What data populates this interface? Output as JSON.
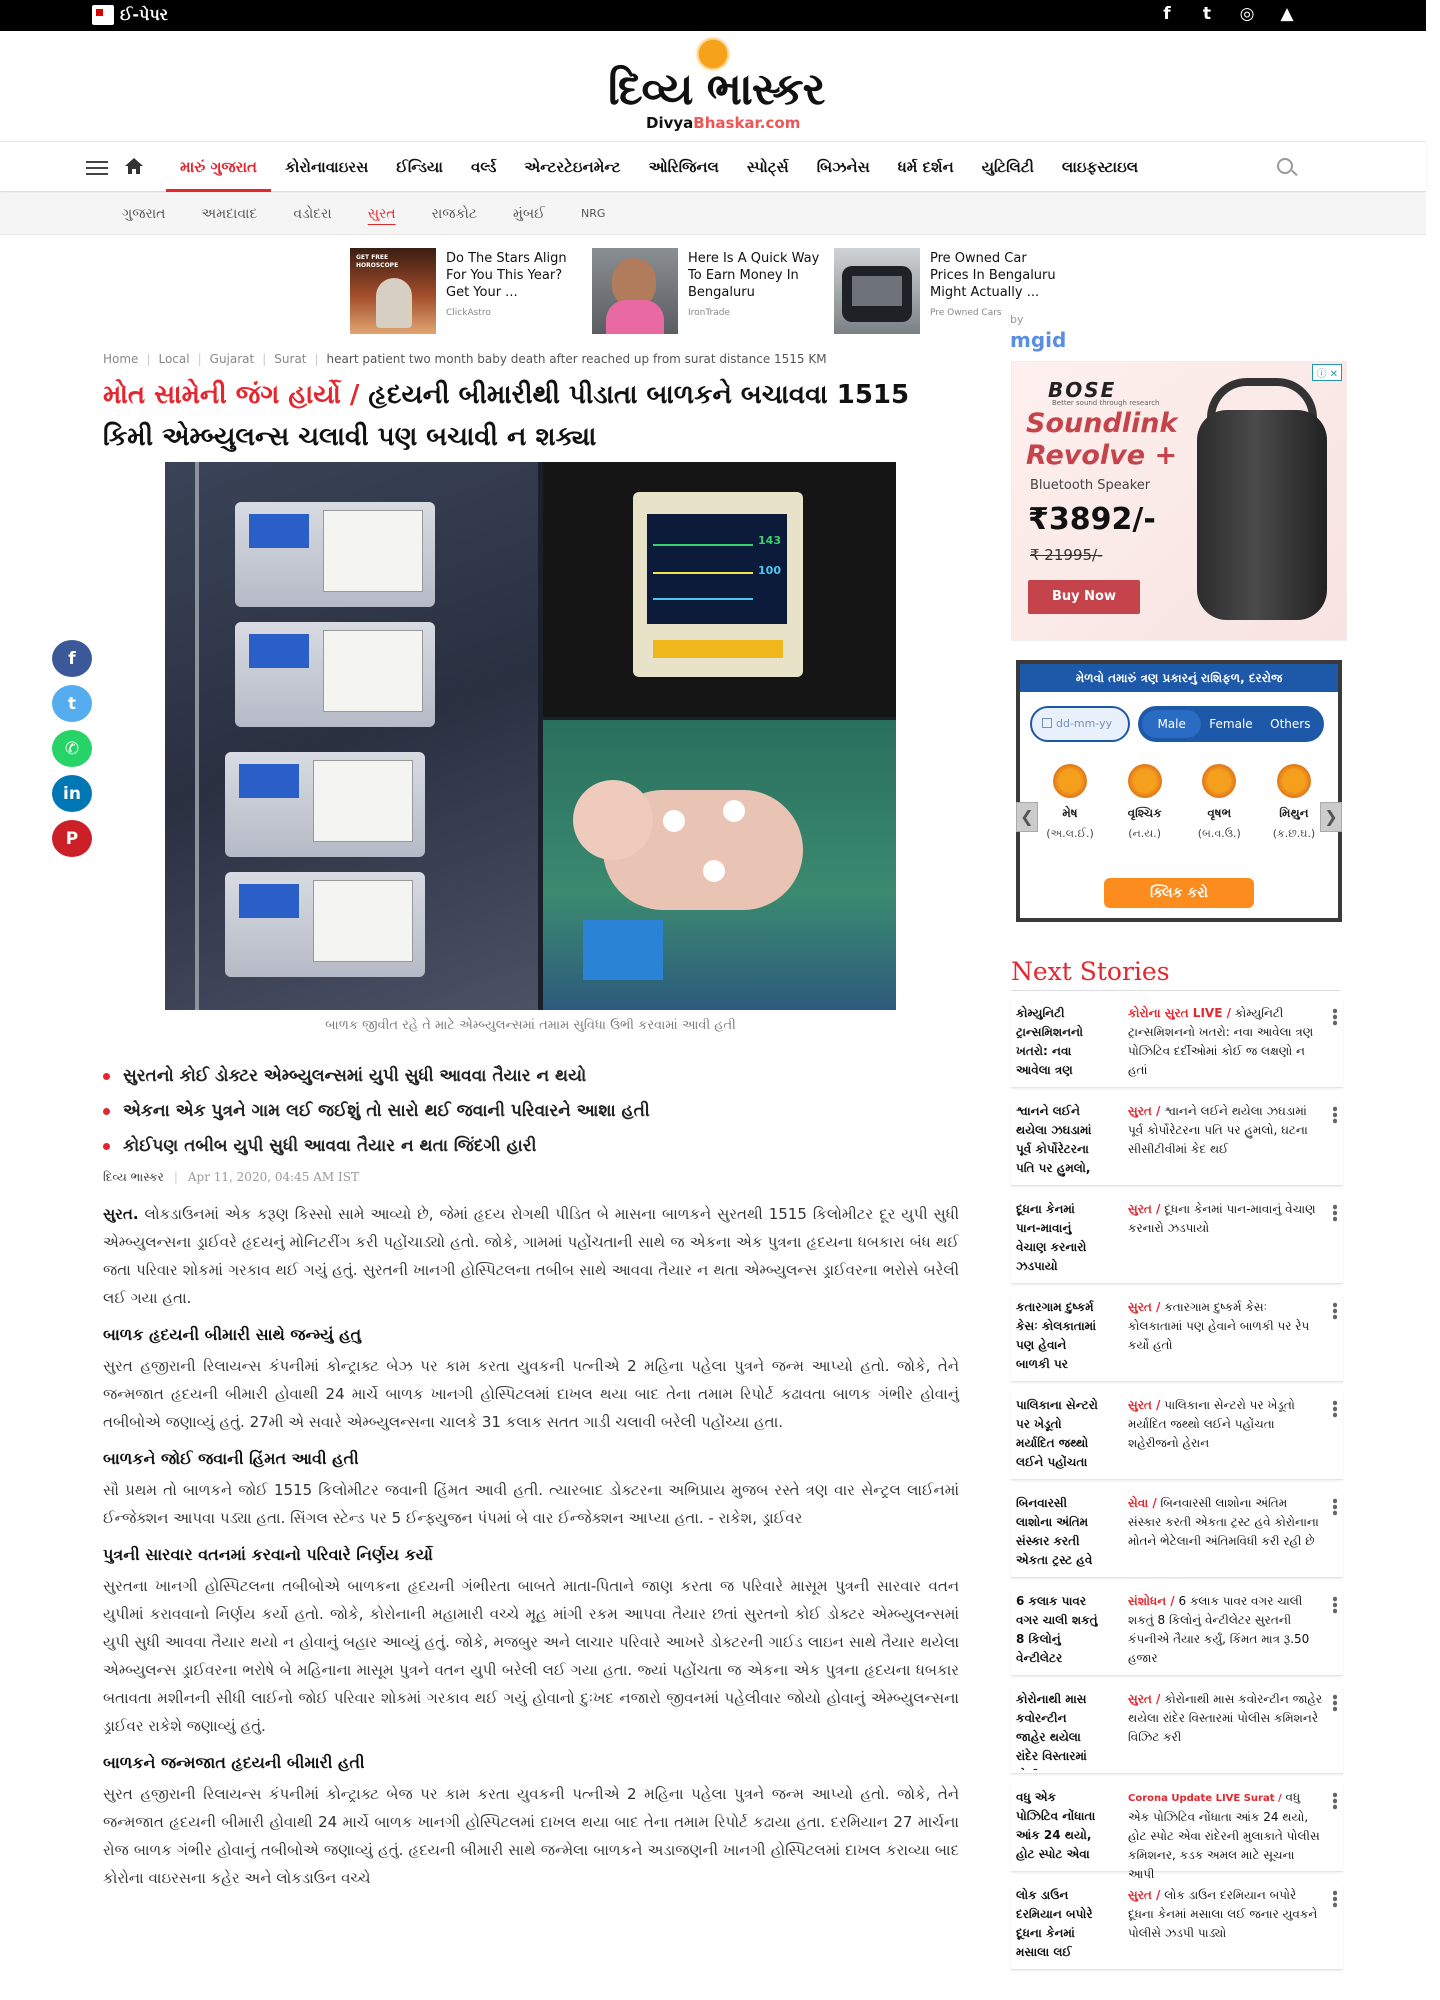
{
  "topbar": {
    "epaper_label": "ઈ-પેપર",
    "social_icons": [
      "facebook-icon",
      "twitter-icon",
      "instagram-icon",
      "android-icon",
      "apple-icon"
    ],
    "social_glyphs": [
      "f",
      "t",
      "◎",
      "▲",
      ""
    ]
  },
  "logo": {
    "text": "દિવ્ય ભાસ્કર",
    "sub_prefix": "Divya",
    "sub_suffix": "Bhaskar.com"
  },
  "nav": {
    "items": [
      "મારું ગુજરાત",
      "કોરોનાવાઇરસ",
      "ઈન્ડિયા",
      "વર્લ્ડ",
      "એન્ટરટેઇનમેન્ટ",
      "ઓરિજિનલ",
      "સ્પોર્ટ્સ",
      "બિઝનેસ",
      "ધર્મ દર્શન",
      "યુટિલિટી",
      "લાઇફસ્ટાઇલ"
    ],
    "active_index": 0
  },
  "subnav": {
    "items": [
      "ગુજરાત",
      "અમદાવાદ",
      "વડોદરા",
      "સુરત",
      "રાજકોટ",
      "મુંબઈ",
      "NRG"
    ],
    "active_index": 3
  },
  "mgid": {
    "cards": [
      {
        "title": "Do The Stars Align For You This Year? Get Your ...",
        "source": "ClickAstro"
      },
      {
        "title": "Here Is A Quick Way To Earn Money In Bengaluru",
        "source": "IronTrade"
      },
      {
        "title": "Pre Owned Car Prices In Bengaluru Might Actually ...",
        "source": "Pre Owned Cars"
      }
    ],
    "by": "by",
    "brand": "mgid"
  },
  "breadcrumb": [
    "Home",
    "Local",
    "Gujarat",
    "Surat",
    "heart patient two month baby death after reached up from surat distance 1515 KM"
  ],
  "headline": {
    "kicker": "મોત સામેની જંગ હાર્યો /",
    "title": "હૃદયની બીમારીથી પીડાતા બાળકને બચાવવા 1515 કિમી એમ્બ્યુલન્સ ચલાવી પણ બચાવી ન શક્યા"
  },
  "hero": {
    "monitor_values": [
      "143",
      "100"
    ],
    "caption": "બાળક જીવીત રહે તે માટે એમ્બ્યુલન્સમાં તમામ સુવિધા ઉભી કરવામાં આવી હતી"
  },
  "bullets": [
    "સુરતનો કોઈ ડોક્ટર એમ્બ્યુલન્સમાં યુપી સુધી આવવા તૈયાર ન થયો",
    "એકના એક પુત્રને ગામ લઈ જઈશું તો સારો થઈ જવાની પરિવારને આશા હતી",
    "કોઈપણ તબીબ યુપી સુધી આવવા તૈયાર ન થતા જિંદગી હારી"
  ],
  "byline": {
    "author": "દિવ્ય ભાસ્કર",
    "time": "Apr 11, 2020, 04:45 AM IST"
  },
  "article": {
    "p1_lead": "સુરત.",
    "p1": " લોકડાઉનમાં એક કરૂણ કિસ્સો સામે આવ્યો  છે, જેમાં હૃદય રોગથી પીડિત બે માસના બાળકને સુરતથી 1515 કિલોમીટર દૂર યુપી સુધી એમ્બ્યુલન્સના ડ્રાઈવરે હૃદયનું મોનિટરીંગ કરી પહોંચાડ્યો હતો. જોકે, ગામમાં પહોંચતાની સાથે જ એકના એક પુત્રના હૃદયના ધબકારા બંધ થઈ જતા પરિવાર શોકમાં ગરકાવ થઈ ગયું હતું. સુરતની ખાનગી હોસ્પિટલના તબીબ સાથે આવવા તૈયાર ન થતા એમ્બ્યુલન્સ ડ્રાઈવરના ભરોસે  બરેલી લઈ ગયા હતા.",
    "h1": "બાળક હૃદયની બીમારી સાથે જન્મ્યું હતુ",
    "p2": "સુરત હજીરાની રિલાયન્સ કંપનીમાં કોન્ટ્રાક્ટ બેઝ પર કામ કરતા યુવકની પત્નીએ 2 મહિના પહેલા પુત્રને જન્મ આપ્યો હતો. જોકે, તેને જન્મજાત  હૃદયની બીમારી હોવાથી 24 માર્ચે બાળક ખાનગી હોસ્પિટલમાં દાખલ થયા બાદ તેના તમામ રિપોર્ટ કઢાવતા બાળક ગંભીર હોવાનું તબીબોએ જણાવ્યું હતું. 27મી એ સવારે એમ્બ્યુલન્સના ચાલકે 31 કલાક સતત ગાડી ચલાવી બરેલી પહોંચ્યા હતા.",
    "h2": "બાળકને જોઈ જવાની હિંમત આવી હતી",
    "p3": "સૌ પ્રથમ તો બાળકને જોઈ 1515 કિલોમીટર જવાની હિંમત આવી હતી. ત્યારબાદ ડોક્ટરના અભિપ્રાય મુજબ રસ્તે ત્રણ વાર સેન્ટ્રલ લાઈનમાં ઈન્જેક્શન આપવા પડ્યા હતા. સિંગલ સ્ટેન્ડ પર 5 ઈન્ફ્યુજન પંપમાં બે વાર ઈન્જેક્શન આપ્યા હતા. - રાકેશ, ડ્રાઈવર",
    "h3": "પુત્રની સારવાર વતનમાં કરવાનો પરિવારે નિર્ણય કર્યો",
    "p4": "સુરતના ખાનગી હોસ્પિટલના તબીબોએ બાળકના હૃદયની ગંભીરતા બાબતે માતા-પિતાને જાણ કરતા જ પરિવારે માસૂમ પુત્રની સારવાર વતન યુપીમાં કરાવવાનો નિર્ણય કર્યો હતો. જોકે, કોરોનાની મહામારી વચ્ચે મૂહ માંગી રકમ આપવા તૈયાર છતાં સુરતનો કોઈ ડોક્ટર એમ્બ્યુલન્સમાં યુપી સુધી આવવા તૈયાર થયો ન હોવાનું બહાર આવ્યું હતું. જોકે, મજબુર અને લાચાર પરિવારે આખરે ડોક્ટરની ગાઈડ લાઇન સાથે તૈયાર થયેલા એમ્બ્યુલન્સ ડ્રાઈવરના ભરોષે બે મહિનાના માસૂમ પુત્રને વતન યુપી બરેલી લઈ ગયા હતા. જ્યાં પહોંચતા જ એકના એક પુત્રના હૃદયના ધબકાર બતાવતા મશીનની સીધી લાઈનો જોઈ પરિવાર શોકમાં ગરકાવ થઈ ગયું હોવાનો દુઃખદ નજારો જીવનમાં પહેલીવાર જોયો હોવાનું એમ્બ્યુલન્સના ડ્રાઈવર રાકેશે જણાવ્યું હતું.",
    "h4": "બાળકને જન્મજાત હૃદયની બીમારી હતી",
    "p5": "સુરત હજીરાની રિલાયન્સ કંપનીમાં કોન્ટ્રાક્ટ બેજ પર કામ કરતા યુવકની પત્નીએ 2 મહિના પહેલા પુત્રને જન્મ આપ્યો હતો. જોકે, તેને જન્મજાત  હૃદયની બીમારી હોવાથી 24 માર્ચે બાળક ખાનગી હોસ્પિટલમાં દાખલ થયા બાદ તેના તમામ રિપોર્ટ કઢાયા હતા. દરમિયાન 27 માર્ચના રોજ બાળક ગંભીર હોવાનું તબીબોએ જણાવ્યું હતું. હૃદયની બીમારી સાથે જન્મેલા બાળકને અડાજણની ખાનગી હોસ્પિટલમાં દાખલ કરાવ્યા બાદ કોરોના વાઇરસના કહેર અને લોકડાઉન વચ્ચે"
  },
  "share": {
    "icons": [
      "facebook-share-icon",
      "twitter-share-icon",
      "whatsapp-share-icon",
      "linkedin-share-icon",
      "pinterest-share-icon"
    ],
    "glyphs": [
      "f",
      "t",
      "✆",
      "in",
      "P"
    ],
    "colors": [
      "#3b5998",
      "#55acee",
      "#25d366",
      "#0077b5",
      "#cb2027"
    ]
  },
  "bose_ad": {
    "brand": "BOSE",
    "tagline": "Better sound through research",
    "product": "Soundlink Revolve +",
    "subtitle": "Bluetooth Speaker",
    "price": "₹3892/-",
    "old_price": "₹ 21995/-",
    "cta": "Buy Now",
    "adchoice": "ⓘ ✕"
  },
  "rashifal": {
    "heading": "મેળવો તમારું ત્રણ પ્રકારનું રાશિફળ, દરરોજ",
    "date_placeholder": "dd-mm-yy",
    "genders": [
      "Male",
      "Female",
      "Others"
    ],
    "selected_gender": 0,
    "signs": [
      {
        "name": "મેષ",
        "letters": "(અ.લ.ઈ.)"
      },
      {
        "name": "વૃશ્ચિક",
        "letters": "(ન.ય.)"
      },
      {
        "name": "વૃષભ",
        "letters": "(બ.વ.ઉ.)"
      },
      {
        "name": "મિથુન",
        "letters": "(ક.છ.ઘ.)"
      }
    ],
    "cta": "ક્લિક કરો",
    "prev": "❮",
    "next": "❯"
  },
  "next_stories": {
    "title": "Next Stories",
    "items": [
      {
        "thumb_alt": "કોમ્યુનિટી ટ્રાન્સમિશનનો ખતરો: નવા આવેલા ત્રણ",
        "kicker": "કોરોના સુરત LIVE /",
        "text": "કોમ્યુનિટી ટ્રાન્સમિશનનો ખતરો: નવા આવેલા ત્રણ પોઝિટિવ દર્દીઓમાં કોઈ જ લક્ષણો ન હતાં"
      },
      {
        "thumb_alt": "શ્વાનને લઈને થયેલા ઝઘડામાં પૂર્વ કોર્પોરેટરના પતિ પર હુમલો,",
        "kicker": "સુરત /",
        "text": "શ્વાનને લઈને થયેલા ઝઘડામાં પૂર્વ કોર્પોરેટરના પતિ પર હુમલો, ઘટના સીસીટીવીમાં કેદ થઈ"
      },
      {
        "thumb_alt": "દૂધના કેનમાં પાન-માવાનું વેચાણ કરનારો ઝડપાયો",
        "kicker": "સુરત /",
        "text": "દૂધના કેનમાં પાન-માવાનું વેચાણ કરનારો ઝડપાયો"
      },
      {
        "thumb_alt": "કતારગામ દુષ્કર્મ કેસઃ કોલકાતામાં પણ હેવાને બાળકી પર",
        "kicker": "સુરત /",
        "text": "કતારગામ દુષ્કર્મ કેસઃ કોલકાતામાં પણ હેવાને બાળકી પર રેપ કર્યો હતો"
      },
      {
        "thumb_alt": "પાલિકાના સેન્ટરો પર ખેડૂતો મર્યાદિત જથ્થો લઈને પહોંચતા",
        "kicker": "સુરત /",
        "text": "પાલિકાના સેન્ટરો પર ખેડૂતો મર્યાદિત જથ્થો લઈને પહોંચતા શહેરીજનો હેરાન"
      },
      {
        "thumb_alt": "બિનવારસી લાશોના અંતિમ સંસ્કાર કરતી એકતા ટ્રસ્ટ હવે",
        "kicker": "સેવા /",
        "text": "બિનવારસી લાશોના અંતિમ સંસ્કાર કરતી એકતા ટ્રસ્ટ હવે કોરોનાના મોતને ભેટેલાની અંતિમવિધી કરી રહી છે"
      },
      {
        "thumb_alt": "6 કલાક પાવર વગર ચાલી શકતું 8 કિલોનું વેન્ટીલેટર",
        "kicker": "સંશોધન /",
        "text": "6 કલાક પાવર વગર ચાલી શકતું 8 કિલોનું વેન્ટીલેટર સુરતની કંપનીએ તૈયાર કર્યું, કિંમત માત્ર રૂ.50 હજાર"
      },
      {
        "thumb_alt": "કોરોનાથી માસ કવોરન્ટીન જાહેર થયેલા રાંદેર વિસ્તારમાં પોલીસ",
        "kicker": "સુરત /",
        "text": "કોરોનાથી માસ કવોરન્ટીન જાહેર થયેલા રાંદેર વિસ્તારમાં પોલીસ કમિશનરે વિઝિટ કરી"
      },
      {
        "thumb_alt": "વધુ એક પોઝિટિવ નોંધાતા આંક 24 થયો, હોટ સ્પોટ એવા",
        "kicker": "Corona Update LIVE Surat /",
        "text": "વધુ એક પોઝિટિવ નોંધાતા આંક 24 થયો, હોટ સ્પોટ એવા રાંદેરની મુલાકાતે પોલીસ કમિશનર, કડક અમલ માટે સૂચના આપી"
      },
      {
        "thumb_alt": "લોક ડાઉન દરમિયાન બપોરે દૂધના કેનમાં મસાલા લઈ",
        "kicker": "સુરત /",
        "text": "લોક ડાઉન દરમિયાન બપોરે દૂધના કેનમાં મસાલા લઈ જનાર યુવકને પોલીસે ઝડપી પાડ્યો"
      }
    ]
  }
}
